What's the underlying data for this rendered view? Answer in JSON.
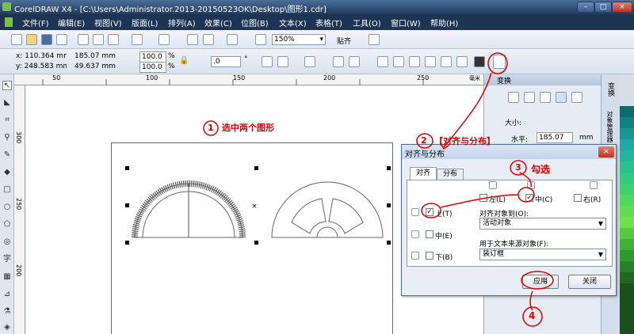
{
  "window": {
    "title": "CorelDRAW X4 - [C:\\Users\\Administrator.2013-20150523OK\\Desktop\\图形1.cdr]",
    "minimize": "–",
    "maximize": "□",
    "close": "×"
  },
  "menu": [
    "文件(F)",
    "编辑(E)",
    "视图(V)",
    "版面(L)",
    "排列(A)",
    "效果(C)",
    "位图(B)",
    "文本(X)",
    "表格(T)",
    "工具(O)",
    "窗口(W)",
    "帮助(H)"
  ],
  "toolbar": {
    "zoom": "150%",
    "snap": "贴齐"
  },
  "propbar": {
    "x": "x: 110.364 mm",
    "y": "y: 248.583 mm",
    "w": "185.07 mm",
    "h": "49.637 mm",
    "sx": "100.0",
    "sy": "100.0",
    "pct": "%",
    "angle": ".0",
    "deg": "°"
  },
  "ruler": {
    "top": [
      "50",
      "100",
      "150",
      "200",
      "250",
      "毫米"
    ],
    "left": [
      "300",
      "250",
      "200"
    ]
  },
  "docker": {
    "title": "变换",
    "size_label": "大小:",
    "h_label": "水平:",
    "h_value": "185.07",
    "unit": "mm"
  },
  "docker_tabs": [
    "变换",
    "对象管理器"
  ],
  "dialog": {
    "title": "对齐与分布",
    "tab_align": "对齐",
    "tab_distribute": "分布",
    "left": "左(L)",
    "center": "中(C)",
    "right": "右(R)",
    "top": "上(T)",
    "middle": "中(E)",
    "bottom": "下(B)",
    "align_to_label": "对齐对象到(O):",
    "align_to_value": "活动对象",
    "text_source_label": "用于文本来源对象(F):",
    "text_source_value": "装订框",
    "apply": "应用",
    "close": "关闭",
    "close_x": "×",
    "checked_mark": "✓"
  },
  "annotations": {
    "a1": "选中两个图形",
    "a2": "【对齐与分布】",
    "a3": "勾选",
    "n1": "1",
    "n2": "2",
    "n3": "3",
    "n4": "4"
  },
  "colors": {
    "accent": "#e00000",
    "titlebar": "#203a5c"
  }
}
